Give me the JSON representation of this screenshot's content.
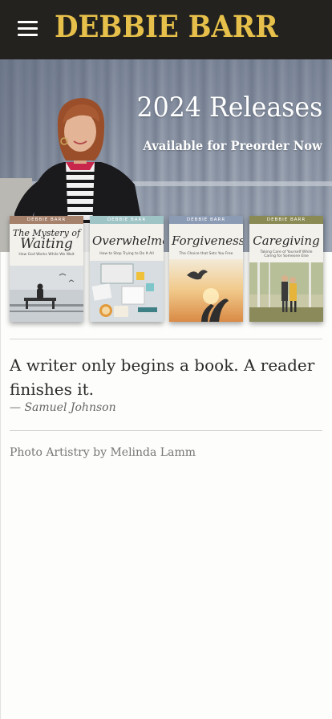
{
  "header": {
    "title": "DEBBIE BARR",
    "menu_icon": "hamburger-menu-icon",
    "brand_color": "#e6c04a",
    "background": "#24221e"
  },
  "hero": {
    "heading": "2024 Releases",
    "subheading": "Available for Preorder Now"
  },
  "books": [
    {
      "author": "DEBBIE BARR",
      "title_line1": "The Mystery of",
      "title_line2": "Waiting",
      "subtitle": "How God Works While We Wait",
      "band_color": "#a5806a"
    },
    {
      "author": "DEBBIE BARR",
      "title_line1": "Overwhelmed",
      "title_line2": "",
      "subtitle": "How to Stop Trying to Do It All",
      "band_color": "#9fc4c6"
    },
    {
      "author": "DEBBIE BARR",
      "title_line1": "Forgiveness",
      "title_line2": "",
      "subtitle": "The Choice that Sets You Free",
      "band_color": "#8c9bb4"
    },
    {
      "author": "DEBBIE BARR",
      "title_line1": "Caregiving",
      "title_line2": "",
      "subtitle": "Taking Care of Yourself While Caring for Someone Else",
      "band_color": "#8a8a55"
    }
  ],
  "quote": {
    "text": "A writer only begins a book. A reader finishes it.",
    "author": "— Samuel Johnson"
  },
  "credit": "Photo Artistry by Melinda Lamm"
}
